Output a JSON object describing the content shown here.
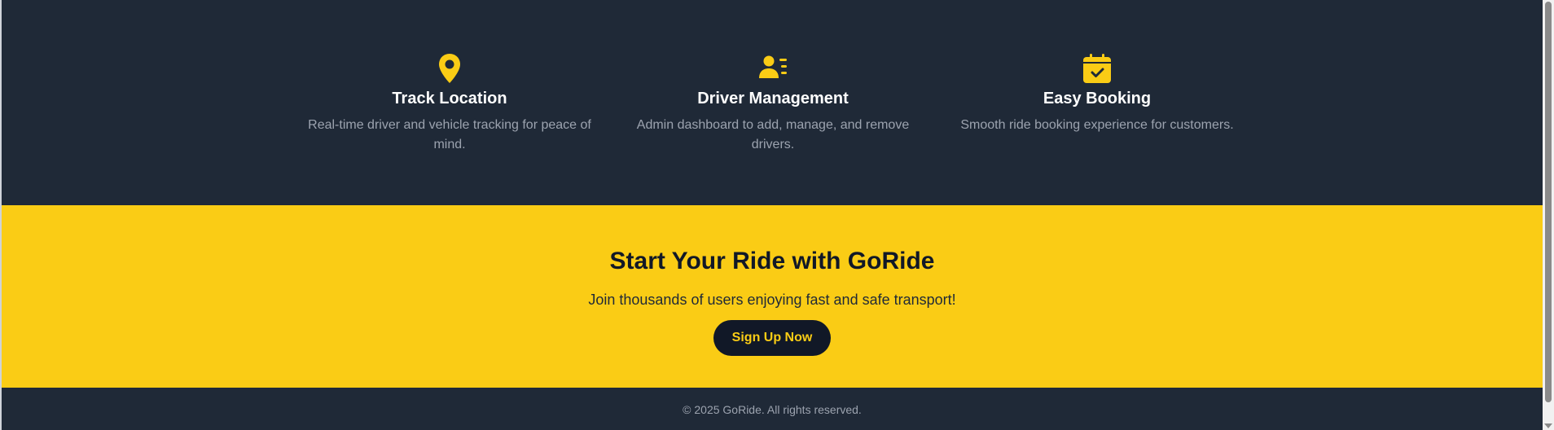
{
  "features": [
    {
      "icon": "location-pin-icon",
      "title": "Track Location",
      "description": "Real-time driver and vehicle tracking for peace of mind."
    },
    {
      "icon": "driver-list-icon",
      "title": "Driver Management",
      "description": "Admin dashboard to add, manage, and remove drivers."
    },
    {
      "icon": "calendar-check-icon",
      "title": "Easy Booking",
      "description": "Smooth ride booking experience for customers."
    }
  ],
  "cta": {
    "heading": "Start Your Ride with GoRide",
    "subtext": "Join thousands of users enjoying fast and safe transport!",
    "button_label": "Sign Up Now"
  },
  "footer": {
    "copyright": "© 2025 GoRide. All rights reserved."
  },
  "colors": {
    "dark_bg": "#1f2937",
    "accent_yellow": "#facc15",
    "muted_text": "#9ca3af"
  }
}
